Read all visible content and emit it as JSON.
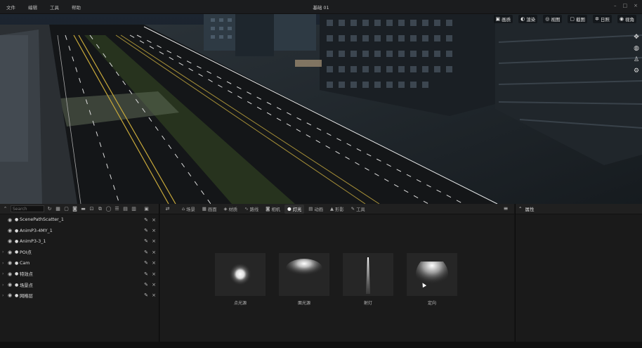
{
  "menu": {
    "items": [
      "文件",
      "编辑",
      "工具",
      "帮助"
    ],
    "title": "基础 01"
  },
  "window_controls": [
    "–",
    "□",
    "×"
  ],
  "viewport": {
    "tools": [
      {
        "icon": "view-icon",
        "glyph": "▣",
        "label": "画质"
      },
      {
        "icon": "render-icon",
        "glyph": "◐",
        "label": "渲染"
      },
      {
        "icon": "camera-view-icon",
        "glyph": "◎",
        "label": "视图"
      },
      {
        "icon": "screenshot-icon",
        "glyph": "▢",
        "label": "截图"
      },
      {
        "icon": "sun-icon",
        "glyph": "✲",
        "label": "日照"
      },
      {
        "icon": "eye-icon",
        "glyph": "◉",
        "label": "视角"
      }
    ],
    "side_icons": [
      {
        "icon": "move-icon",
        "glyph": "✥"
      },
      {
        "icon": "globe-icon",
        "glyph": "◍"
      },
      {
        "icon": "person-icon",
        "glyph": "♙"
      },
      {
        "icon": "settings-icon",
        "glyph": "⚙"
      }
    ]
  },
  "outliner": {
    "search_placeholder": "Search",
    "items": [
      {
        "label": "ScenePathScatter_1",
        "expandable": false
      },
      {
        "label": "AnimP3-4MY_1",
        "expandable": false
      },
      {
        "label": "AnimP3-3_1",
        "expandable": false
      },
      {
        "label": "POI点",
        "expandable": true
      },
      {
        "label": "Cam",
        "expandable": true
      },
      {
        "label": "特效点",
        "expandable": true
      },
      {
        "label": "场景点",
        "expandable": true
      },
      {
        "label": "网格层",
        "expandable": true
      }
    ]
  },
  "content_browser": {
    "tabs": [
      {
        "icon": "scene-icon",
        "glyph": "⌂",
        "label": "场景",
        "active": false
      },
      {
        "icon": "image-icon",
        "glyph": "▦",
        "label": "画面",
        "active": false
      },
      {
        "icon": "material-icon",
        "glyph": "◈",
        "label": "材质",
        "active": false
      },
      {
        "icon": "path-icon",
        "glyph": "∿",
        "label": "路线",
        "active": false
      },
      {
        "icon": "camera-icon",
        "glyph": "◙",
        "label": "相机",
        "active": false
      },
      {
        "icon": "light-icon",
        "glyph": "●",
        "label": "灯光",
        "active": true
      },
      {
        "icon": "animation-icon",
        "glyph": "▤",
        "label": "动画",
        "active": false
      },
      {
        "icon": "shape-icon",
        "glyph": "▲",
        "label": "形影",
        "active": false
      },
      {
        "icon": "tool-icon",
        "glyph": "✎",
        "label": "工具",
        "active": false
      }
    ],
    "assets": [
      {
        "name": "点光源",
        "kind": "point"
      },
      {
        "name": "面光源",
        "kind": "area"
      },
      {
        "name": "射灯",
        "kind": "spot"
      },
      {
        "name": "定向",
        "kind": "directional"
      }
    ]
  },
  "properties": {
    "title": "属性"
  }
}
